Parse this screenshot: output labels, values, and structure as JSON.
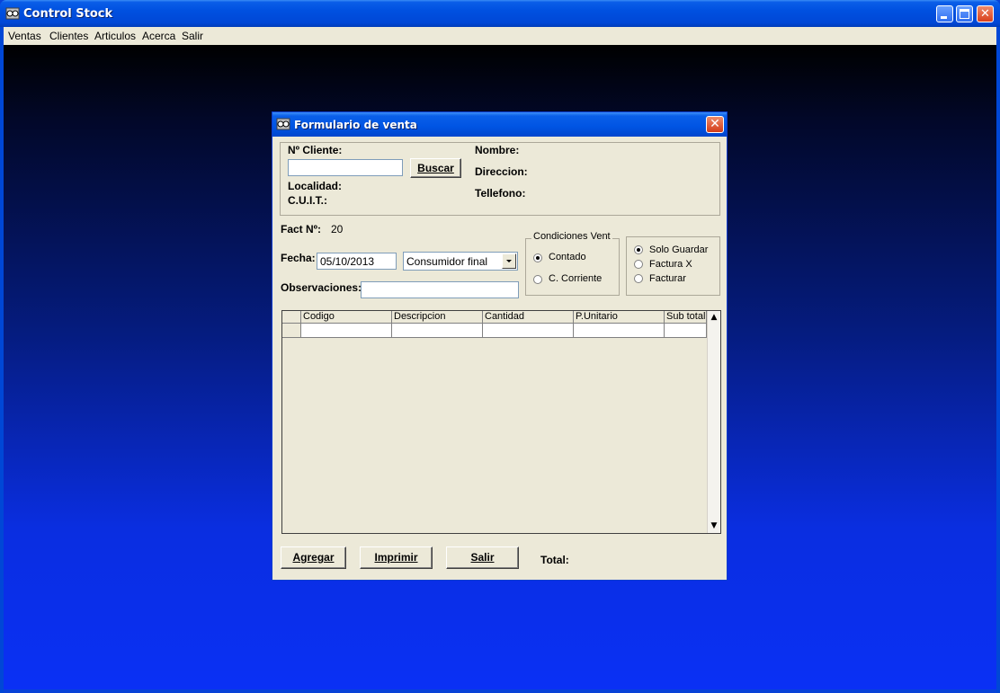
{
  "window": {
    "title": "Control Stock"
  },
  "menu": [
    "Ventas",
    "Clientes",
    "Articulos",
    "Acerca",
    "Salir"
  ],
  "dialog": {
    "title": "Formulario de venta",
    "cliente": {
      "num_label": "Nº Cliente:",
      "num_value": "",
      "buscar": "Buscar",
      "localidad": "Localidad:",
      "cuit": "C.U.I.T.:",
      "nombre": "Nombre:",
      "direccion": "Direccion:",
      "telefono": "Tellefono:"
    },
    "fact_label": "Fact Nº:",
    "fact_value": "20",
    "fecha_label": "Fecha:",
    "fecha_value": "05/10/2013",
    "tipo_select": "Consumidor final",
    "observaciones_label": "Observaciones:",
    "observaciones_value": "",
    "condiciones": {
      "legend": "Condiciones Vent",
      "options": [
        "Contado",
        "C. Corriente"
      ],
      "selected": "Contado"
    },
    "accion": {
      "options": [
        "Solo Guardar",
        "Factura X",
        "Facturar"
      ],
      "selected": "Solo Guardar"
    },
    "grid": {
      "columns": [
        "Codigo",
        "Descripcion",
        "Cantidad",
        "P.Unitario",
        "Sub total"
      ]
    },
    "buttons": {
      "agregar": "Agregar",
      "imprimir": "Imprimir",
      "salir": "Salir"
    },
    "total_label": "Total:"
  },
  "colors": {
    "titlebar": "#0054e3",
    "dialog_bg": "#ece9d8",
    "close": "#d23c18"
  }
}
